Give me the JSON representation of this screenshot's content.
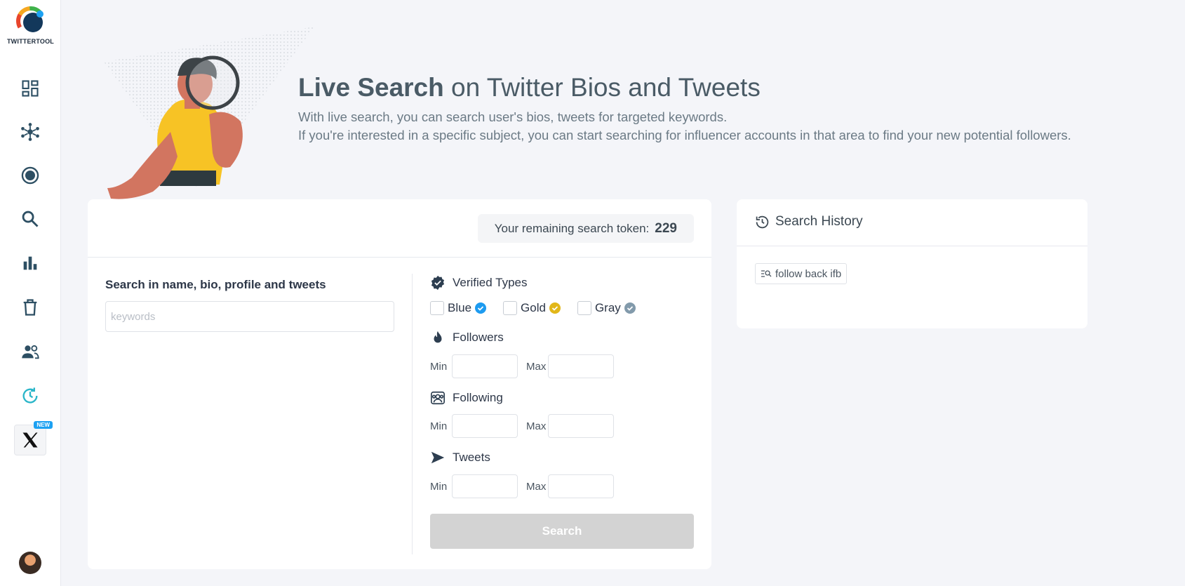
{
  "app": {
    "logo_text": "TWITTERTOOL"
  },
  "sidebar": {
    "items": [
      {
        "icon": "dashboard-icon"
      },
      {
        "icon": "network-icon"
      },
      {
        "icon": "record-icon"
      },
      {
        "icon": "search-icon"
      },
      {
        "icon": "bar-chart-icon"
      },
      {
        "icon": "trash-icon"
      },
      {
        "icon": "people-icon"
      },
      {
        "icon": "history-sync-icon",
        "color": "#2bb6c9"
      },
      {
        "icon": "x-logo-icon",
        "badge": "NEW"
      }
    ]
  },
  "hero": {
    "title_bold": "Live Search",
    "title_rest": " on Twitter Bios and Tweets",
    "desc_line1": "With live search, you can search user's bios, tweets for targeted keywords.",
    "desc_line2": "If you're interested in a specific subject, you can start searching for influencer accounts in that area to find your new potential followers."
  },
  "token": {
    "label": "Your remaining search token:",
    "value": "229"
  },
  "search": {
    "label": "Search in name, bio, profile and tweets",
    "placeholder": "keywords"
  },
  "filters": {
    "verified": {
      "title": "Verified Types",
      "options": [
        {
          "label": "Blue",
          "color": "#1d9bf0"
        },
        {
          "label": "Gold",
          "color": "#e2b719"
        },
        {
          "label": "Gray",
          "color": "#829aab"
        }
      ]
    },
    "followers": {
      "title": "Followers",
      "min_label": "Min",
      "max_label": "Max"
    },
    "following": {
      "title": "Following",
      "min_label": "Min",
      "max_label": "Max"
    },
    "tweets": {
      "title": "Tweets",
      "min_label": "Min",
      "max_label": "Max"
    }
  },
  "search_button": "Search",
  "history": {
    "title": "Search History",
    "items": [
      "follow back ifb"
    ]
  },
  "colors": {
    "accent": "#1d9bf0",
    "background": "#f4f5f9",
    "heading": "#4a5b66"
  }
}
